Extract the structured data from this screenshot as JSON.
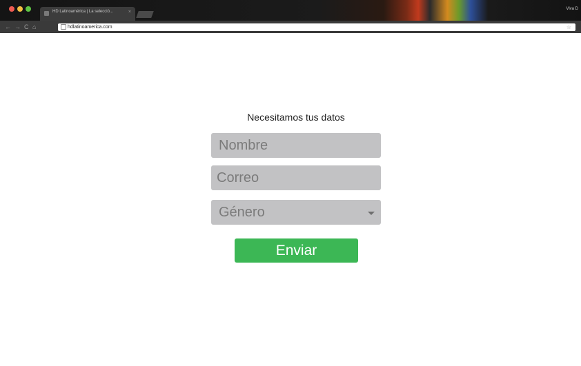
{
  "browser": {
    "tab_title": "HD Latinoamérica | La selecció...",
    "tab_close": "×",
    "profile": "Viva D",
    "url": "hdlatinoamerica.com",
    "nav": {
      "back": "←",
      "forward": "→",
      "reload": "C",
      "home": "⌂"
    },
    "star": "☆"
  },
  "form": {
    "title": "Necesitamos tus datos",
    "name_placeholder": "Nombre",
    "email_placeholder": "Correo",
    "gender_selected": "Género",
    "submit_label": "Enviar"
  },
  "colors": {
    "submit": "#3cb755",
    "field": "#c2c2c4",
    "field_text": "#7b7b7b"
  }
}
